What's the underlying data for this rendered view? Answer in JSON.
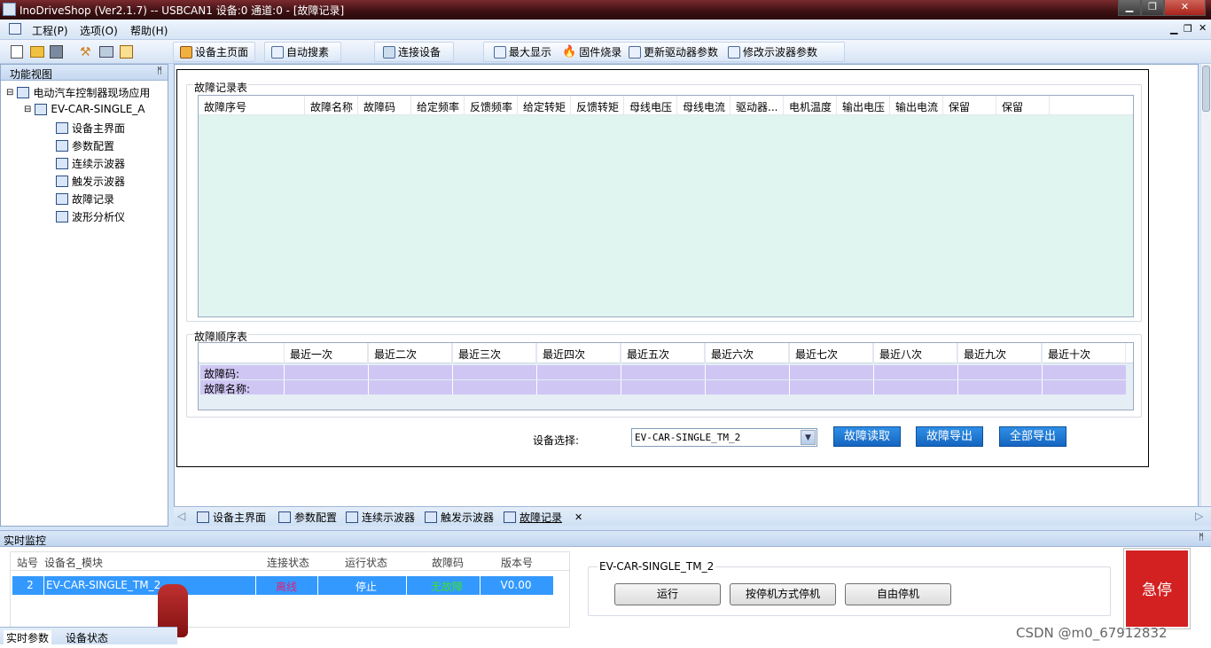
{
  "window": {
    "title": "InoDriveShop (Ver2.1.7) -- USBCAN1 设备:0 通道:0 - [故障记录]"
  },
  "menu": {
    "items": [
      "工程(P)",
      "选项(O)",
      "帮助(H)"
    ]
  },
  "toolbar": {
    "home": "设备主页面",
    "autosearch": "自动搜素",
    "connect": "连接设备",
    "maximize": "最大显示",
    "firmware": "固件烧录",
    "update_params": "更新驱动器参数",
    "scope_params": "修改示波器参数"
  },
  "sidebar": {
    "header": "功能视图",
    "root": "电动汽车控制器现场应用",
    "device": "EV-CAR-SINGLE_A",
    "items": [
      "设备主界面",
      "参数配置",
      "连续示波器",
      "触发示波器",
      "故障记录",
      "波形分析仪"
    ]
  },
  "fault_record": {
    "title": "故障记录表",
    "columns": [
      "故障序号",
      "故障名称",
      "故障码",
      "给定频率",
      "反馈频率",
      "给定转矩",
      "反馈转矩",
      "母线电压",
      "母线电流",
      "驱动器...",
      "电机温度",
      "输出电压",
      "输出电流",
      "保留",
      "保留"
    ]
  },
  "fault_order": {
    "title": "故障顺序表",
    "columns": [
      "最近一次",
      "最近二次",
      "最近三次",
      "最近四次",
      "最近五次",
      "最近六次",
      "最近七次",
      "最近八次",
      "最近九次",
      "最近十次"
    ],
    "row_labels": [
      "故障码:",
      "故障名称:"
    ]
  },
  "device_select": {
    "label": "设备选择:",
    "value": "EV-CAR-SINGLE_TM_2"
  },
  "buttons": {
    "read": "故障读取",
    "export": "故障导出",
    "export_all": "全部导出"
  },
  "tabs": [
    "设备主界面",
    "参数配置",
    "连续示波器",
    "触发示波器",
    "故障记录"
  ],
  "monitor": {
    "header": "实时监控",
    "columns": [
      "站号",
      "设备名_模块",
      "连接状态",
      "运行状态",
      "故障码",
      "版本号"
    ],
    "row": {
      "station": "2",
      "name": "EV-CAR-SINGLE_TM_2",
      "conn": "离线",
      "run": "停止",
      "fault": "无故障",
      "version": "V0.00"
    },
    "bottom_tabs": [
      "实时参数",
      "设备状态"
    ]
  },
  "control": {
    "title": "EV-CAR-SINGLE_TM_2",
    "run": "运行",
    "stop_mode": "按停机方式停机",
    "free_stop": "自由停机",
    "estop": "急停"
  },
  "watermark": "CSDN @m0_67912832",
  "colors": {
    "grid_bg": "#e0f4f0",
    "order_bg": "#cfc6f4",
    "selection": "#3399ff",
    "estop": "#d32020",
    "offline": "#e0207a",
    "no_fault": "#3adf30"
  }
}
